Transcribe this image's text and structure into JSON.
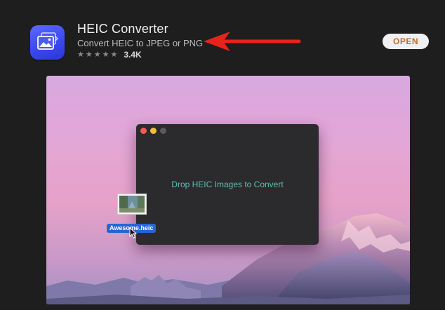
{
  "app": {
    "name": "HEIC Converter",
    "subtitle": "Convert HEIC to JPEG or PNG",
    "rating_count": "3.4K",
    "stars": 5,
    "open_label": "OPEN",
    "icon": "photo-stack-icon"
  },
  "annotation": {
    "arrow_color": "#e8231a"
  },
  "preview": {
    "drop_text": "Drop HEIC Images to Convert",
    "file_name": "Awesome.heic"
  },
  "colors": {
    "background": "#1e1e1e",
    "open_text": "#c26a2a",
    "accent_blue": "#3c49f0",
    "drop_text": "#58c2b4",
    "file_label_bg": "#2566d6"
  }
}
